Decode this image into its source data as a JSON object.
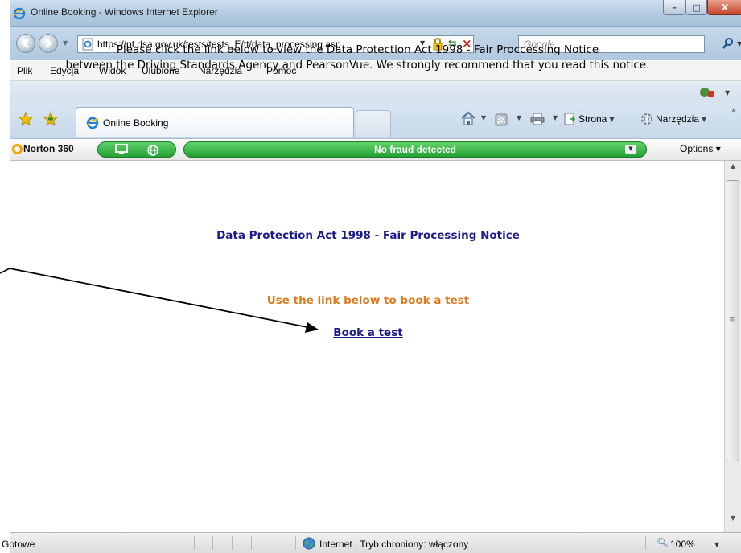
{
  "window": {
    "title": "Online Booking - Windows Internet Explorer",
    "min_glyph": "–",
    "max_glyph": "□",
    "close_glyph": "X"
  },
  "address_bar": {
    "url": "https://pt.dsa.gov.uk/tests/tests_E/tt/data_processing.asp",
    "search_placeholder": "Google"
  },
  "menu": {
    "items": [
      "Plik",
      "Edycja",
      "Widok",
      "Ulubione",
      "Narzędzia",
      "Pomoc"
    ]
  },
  "tabs": {
    "active_label": "Online Booking"
  },
  "command_bar": {
    "page_label": "Strona",
    "tools_label": "Narzędzia",
    "overflow": "»"
  },
  "norton": {
    "label": "Norton 360",
    "status": "No fraud detected",
    "options_label": "Options ▾"
  },
  "page": {
    "intro_line1": "Please click the link below to view the Data Protection Act 1998 - Fair Proccessing Notice",
    "intro_line2": "between the Driving Standards Agency and PearsonVue. We strongly recommend that you read this notice.",
    "notice_link": "Data Protection Act 1998 - Fair Processing Notice",
    "book_heading": "Use the link below to book a test",
    "book_link": "Book a test"
  },
  "status_bar": {
    "status": "Gotowe",
    "zone": "Internet | Tryb chroniony: włączony",
    "zoom": "100%"
  },
  "colors": {
    "link": "#1a1a8c",
    "heading_orange": "#e07a1f",
    "norton_green": "#22a033"
  }
}
